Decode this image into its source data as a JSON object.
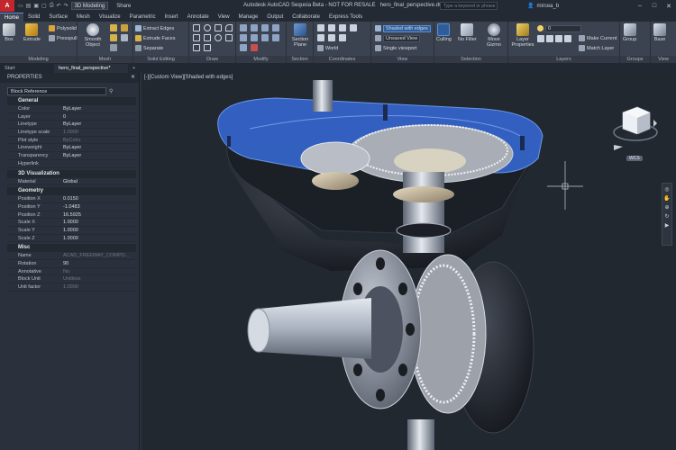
{
  "app": {
    "logo": "A",
    "workspace": "3D Modeling",
    "share": "Share",
    "title": "Autodesk AutoCAD Sequoia Beta - NOT FOR RESALE",
    "filename": "hero_final_perspective.dwg",
    "search_placeholder": "Type a keyword or phrase",
    "user": "mircea_b"
  },
  "ribbon_tabs": [
    "Home",
    "Solid",
    "Surface",
    "Mesh",
    "Visualize",
    "Parametric",
    "Insert",
    "Annotate",
    "View",
    "Manage",
    "Output",
    "Collaborate",
    "Express Tools"
  ],
  "panels": {
    "modeling": {
      "title": "Modeling",
      "box": "Box",
      "extrude": "Extrude",
      "polysolid": "Polysolid",
      "presspull": "Presspull"
    },
    "mesh": {
      "title": "Mesh",
      "smooth": "Smooth Object"
    },
    "solid_editing": {
      "title": "Solid Editing",
      "extract_edges": "Extract Edges",
      "extrude_faces": "Extrude Faces",
      "separate": "Separate"
    },
    "draw": {
      "title": "Draw"
    },
    "modify": {
      "title": "Modify"
    },
    "section": {
      "title": "Section",
      "section_plane": "Section Plane"
    },
    "coordinates": {
      "title": "Coordinates",
      "world": "World"
    },
    "view": {
      "title": "View",
      "visual_style": "Shaded with edges",
      "saved_view": "Unsaved View",
      "viewport": "Single viewport"
    },
    "selection": {
      "title": "Selection",
      "culling": "Culling",
      "no_filter": "No Filter",
      "move_gizmo": "Move Gizmo"
    },
    "layers": {
      "title": "Layers",
      "layer_props": "Layer Properties",
      "layer_value": "0",
      "make_current": "Make Current",
      "match_layer": "Match Layer"
    },
    "groups": {
      "title": "Groups",
      "group": "Group"
    },
    "view2": {
      "title": "View",
      "base": "Base"
    }
  },
  "doc_tabs": [
    "Start",
    "hero_final_perspective*"
  ],
  "properties": {
    "header": "PROPERTIES",
    "selection": "Block Reference",
    "sections": [
      {
        "name": "General",
        "rows": [
          {
            "k": "Color",
            "v": "ByLayer",
            "dim": false
          },
          {
            "k": "Layer",
            "v": "0",
            "dim": false
          },
          {
            "k": "Linetype",
            "v": "ByLayer",
            "dim": false
          },
          {
            "k": "Linetype scale",
            "v": "1.0000",
            "dim": true
          },
          {
            "k": "Plot style",
            "v": "ByColor",
            "dim": true
          },
          {
            "k": "Lineweight",
            "v": "ByLayer",
            "dim": false
          },
          {
            "k": "Transparency",
            "v": "ByLayer",
            "dim": false
          },
          {
            "k": "Hyperlink",
            "v": "",
            "dim": false
          }
        ]
      },
      {
        "name": "3D Visualization",
        "rows": [
          {
            "k": "Material",
            "v": "Global",
            "dim": false
          }
        ]
      },
      {
        "name": "Geometry",
        "rows": [
          {
            "k": "Position X",
            "v": "0.0150",
            "dim": false
          },
          {
            "k": "Position Y",
            "v": "-1.0483",
            "dim": false
          },
          {
            "k": "Position Z",
            "v": "16.5925",
            "dim": false
          },
          {
            "k": "Scale X",
            "v": "1.0000",
            "dim": false
          },
          {
            "k": "Scale Y",
            "v": "1.0000",
            "dim": false
          },
          {
            "k": "Scale Z",
            "v": "1.0000",
            "dim": false
          }
        ]
      },
      {
        "name": "Misc",
        "rows": [
          {
            "k": "Name",
            "v": "ACAD_FREEWAY_COMPO...",
            "dim": true
          },
          {
            "k": "Rotation",
            "v": "90",
            "dim": false
          },
          {
            "k": "Annotative",
            "v": "No",
            "dim": true
          },
          {
            "k": "Block Unit",
            "v": "Unitless",
            "dim": true
          },
          {
            "k": "Unit factor",
            "v": "1.0000",
            "dim": true
          }
        ]
      }
    ]
  },
  "viewport": {
    "label": "[-][Custom View][Shaded with edges]",
    "viewcube_face": "RIGHT",
    "wcs": "WCS"
  },
  "colors": {
    "accent": "#5a8fd6",
    "highlight": "#3a6fd8",
    "background": "#212830"
  }
}
